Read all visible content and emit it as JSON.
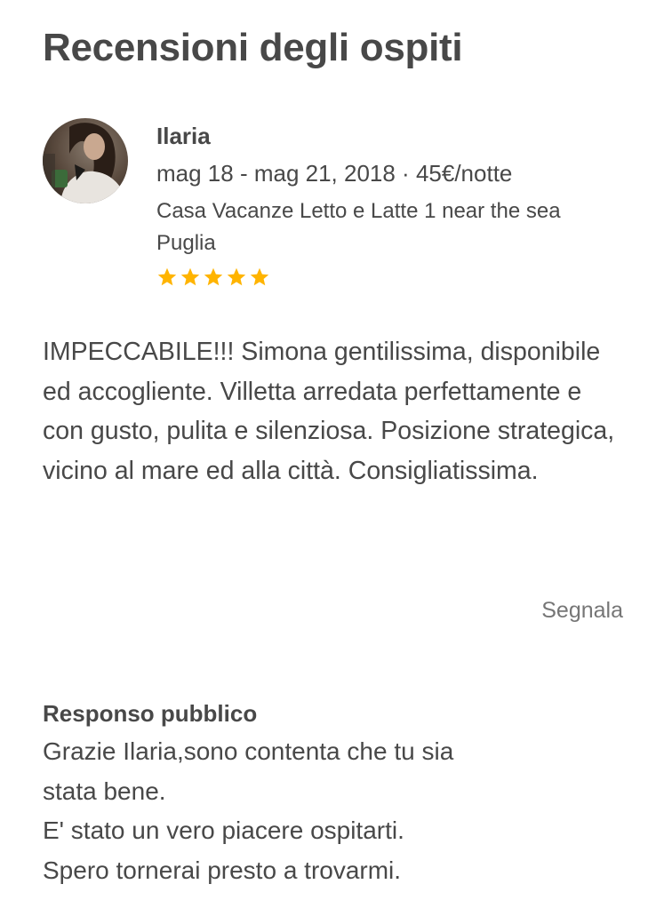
{
  "page": {
    "title": "Recensioni degli ospiti"
  },
  "review": {
    "reviewer_name": "Ilaria",
    "stay_meta": "mag 18 - mag 21, 2018 · 45€/notte",
    "listing_name": "Casa Vacanze Letto e Latte 1 near the sea Puglia",
    "rating": 5,
    "rating_max": 5,
    "avatar_icon": "user-photo",
    "text": "IMPECCABILE!!! Simona gentilissima, disponibile ed accogliente. Villetta arredata perfettamente e con gusto, pulita e silenziosa. Posizione strategica, vicino al mare ed alla città. Consigliatissima.",
    "report_label": "Segnala"
  },
  "response": {
    "title": "Responso pubblico",
    "text": "Grazie Ilaria,sono contenta che tu sia\nstata bene.\nE' stato un vero piacere ospitarti.\nSpero tornerai presto a trovarmi."
  },
  "colors": {
    "text": "#484848",
    "muted": "#767676",
    "star": "#FFB400",
    "background": "#FFFFFF"
  }
}
